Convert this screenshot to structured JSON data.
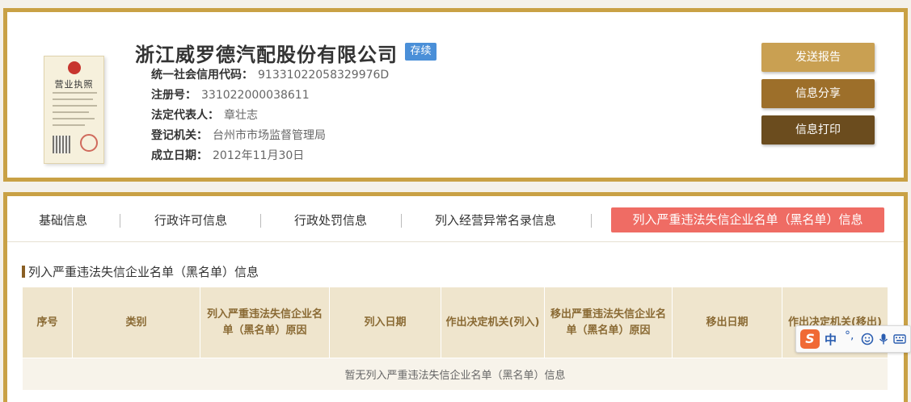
{
  "company": {
    "name": "浙江威罗德汽配股份有限公司",
    "status": "存续",
    "fields": [
      {
        "label": "统一社会信用代码：",
        "value": "91331022058329976D"
      },
      {
        "label": "注册号：",
        "value": "331022000038611"
      },
      {
        "label": "法定代表人：",
        "value": "章壮志"
      },
      {
        "label": "登记机关：",
        "value": "台州市市场监督管理局"
      },
      {
        "label": "成立日期：",
        "value": "2012年11月30日"
      }
    ],
    "license_image": {
      "title": "营业执照"
    }
  },
  "actions": {
    "send_report": "发送报告",
    "share": "信息分享",
    "print": "信息打印"
  },
  "tabs": [
    {
      "label": "基础信息"
    },
    {
      "label": "行政许可信息"
    },
    {
      "label": "行政处罚信息"
    },
    {
      "label": "列入经营异常名录信息"
    },
    {
      "label": "列入严重违法失信企业名单（黑名单）信息",
      "active": true
    }
  ],
  "section": {
    "title": "列入严重违法失信企业名单（黑名单）信息",
    "columns": [
      "序号",
      "类别",
      "列入严重违法失信企业名单（黑名单）原因",
      "列入日期",
      "作出决定机关(列入)",
      "移出严重违法失信企业名单（黑名单）原因",
      "移出日期",
      "作出决定机关(移出)"
    ],
    "empty_message": "暂无列入严重违法失信企业名单（黑名单）信息"
  },
  "ime": {
    "logo": "S",
    "mode": "中",
    "punctuation": "°,",
    "icons": [
      "smile-icon",
      "microphone-icon",
      "keyboard-icon"
    ]
  },
  "colors": {
    "border_gold": "#c9a145",
    "active_tab": "#ef6c64",
    "status_badge": "#4a8fd8",
    "btn_send": "#c9a052",
    "btn_share": "#9d6f2a",
    "btn_print": "#6b4c1e",
    "table_header": "#efe5cd"
  }
}
